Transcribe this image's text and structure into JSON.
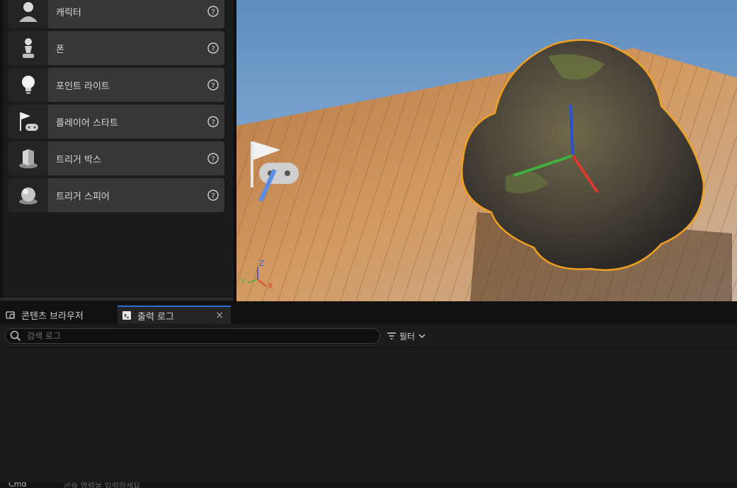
{
  "place_actors": {
    "items": [
      {
        "label": "캐릭터",
        "icon": "character-icon"
      },
      {
        "label": "폰",
        "icon": "pawn-icon"
      },
      {
        "label": "포인트 라이트",
        "icon": "point-light-icon"
      },
      {
        "label": "플레이어 스타트",
        "icon": "player-start-icon"
      },
      {
        "label": "트리거 박스",
        "icon": "trigger-box-icon"
      },
      {
        "label": "트리거 스피어",
        "icon": "trigger-sphere-icon"
      }
    ]
  },
  "viewport": {
    "axis": {
      "x": "X",
      "y": "Y",
      "z": "Z"
    },
    "colors": {
      "sky": "#7aa2c9",
      "floor": "#c58a4e",
      "selection": "#f0a020",
      "x_axis": "#d93a2b",
      "y_axis": "#3fb03f",
      "z_axis": "#2b4fd9"
    }
  },
  "bottom_panel": {
    "tabs": [
      {
        "label": "콘텐츠 브라우저",
        "active": false
      },
      {
        "label": "출력 로그",
        "active": true
      }
    ],
    "close_glyph": "×",
    "search_placeholder": "검색 로그",
    "filter_label": "필터"
  },
  "status_bar": {
    "cmd_label": "Cmd",
    "cmd_placeholder": "콘솔 명령을 입력하세요"
  }
}
